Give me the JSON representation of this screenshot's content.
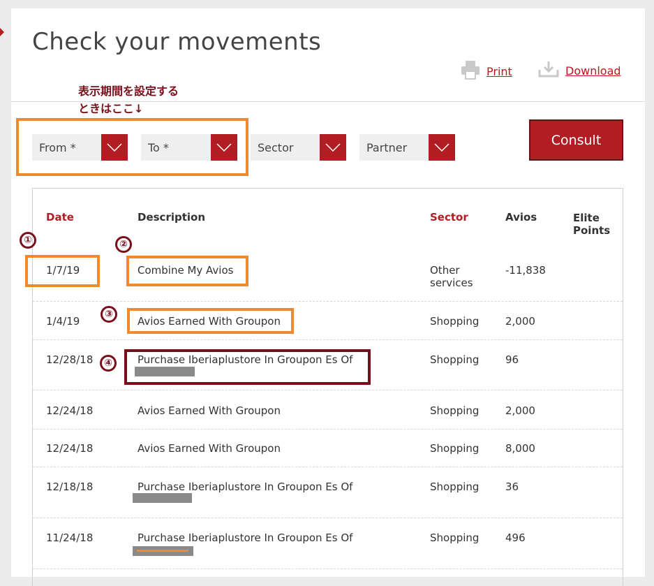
{
  "header": {
    "title": "Check your movements",
    "print_label": "Print",
    "download_label": "Download"
  },
  "annotations": {
    "note_line1": "表示期間を設定する",
    "note_line2": "ときはここ↓",
    "markers": [
      "①",
      "②",
      "③",
      "④"
    ]
  },
  "filters": {
    "from": "From *",
    "to": "To *",
    "sector": "Sector",
    "partner": "Partner",
    "consult_label": "Consult"
  },
  "table": {
    "headers": {
      "date": "Date",
      "description": "Description",
      "sector": "Sector",
      "avios": "Avios",
      "elite_line1": "Elite",
      "elite_line2": "Points"
    },
    "rows": [
      {
        "date": "1/7/19",
        "description": "Combine My Avios",
        "sector": "Other services",
        "avios": "-11,838"
      },
      {
        "date": "1/4/19",
        "description": "Avios Earned With Groupon",
        "sector": "Shopping",
        "avios": "2,000"
      },
      {
        "date": "12/28/18",
        "description": "Purchase Iberiaplustore In Groupon Es Of",
        "sector": "Shopping",
        "avios": "96"
      },
      {
        "date": "12/24/18",
        "description": "Avios Earned With Groupon",
        "sector": "Shopping",
        "avios": "2,000"
      },
      {
        "date": "12/24/18",
        "description": "Avios Earned With Groupon",
        "sector": "Shopping",
        "avios": "8,000"
      },
      {
        "date": "12/18/18",
        "description": "Purchase Iberiaplustore In Groupon Es Of",
        "sector": "Shopping",
        "avios": "36"
      },
      {
        "date": "11/24/18",
        "description": "Purchase Iberiaplustore In Groupon Es Of",
        "sector": "Shopping",
        "avios": "496"
      }
    ]
  },
  "colors": {
    "accent": "#b21d24",
    "annotation_orange": "#f08a2c",
    "annotation_maroon": "#7a0f1c"
  }
}
